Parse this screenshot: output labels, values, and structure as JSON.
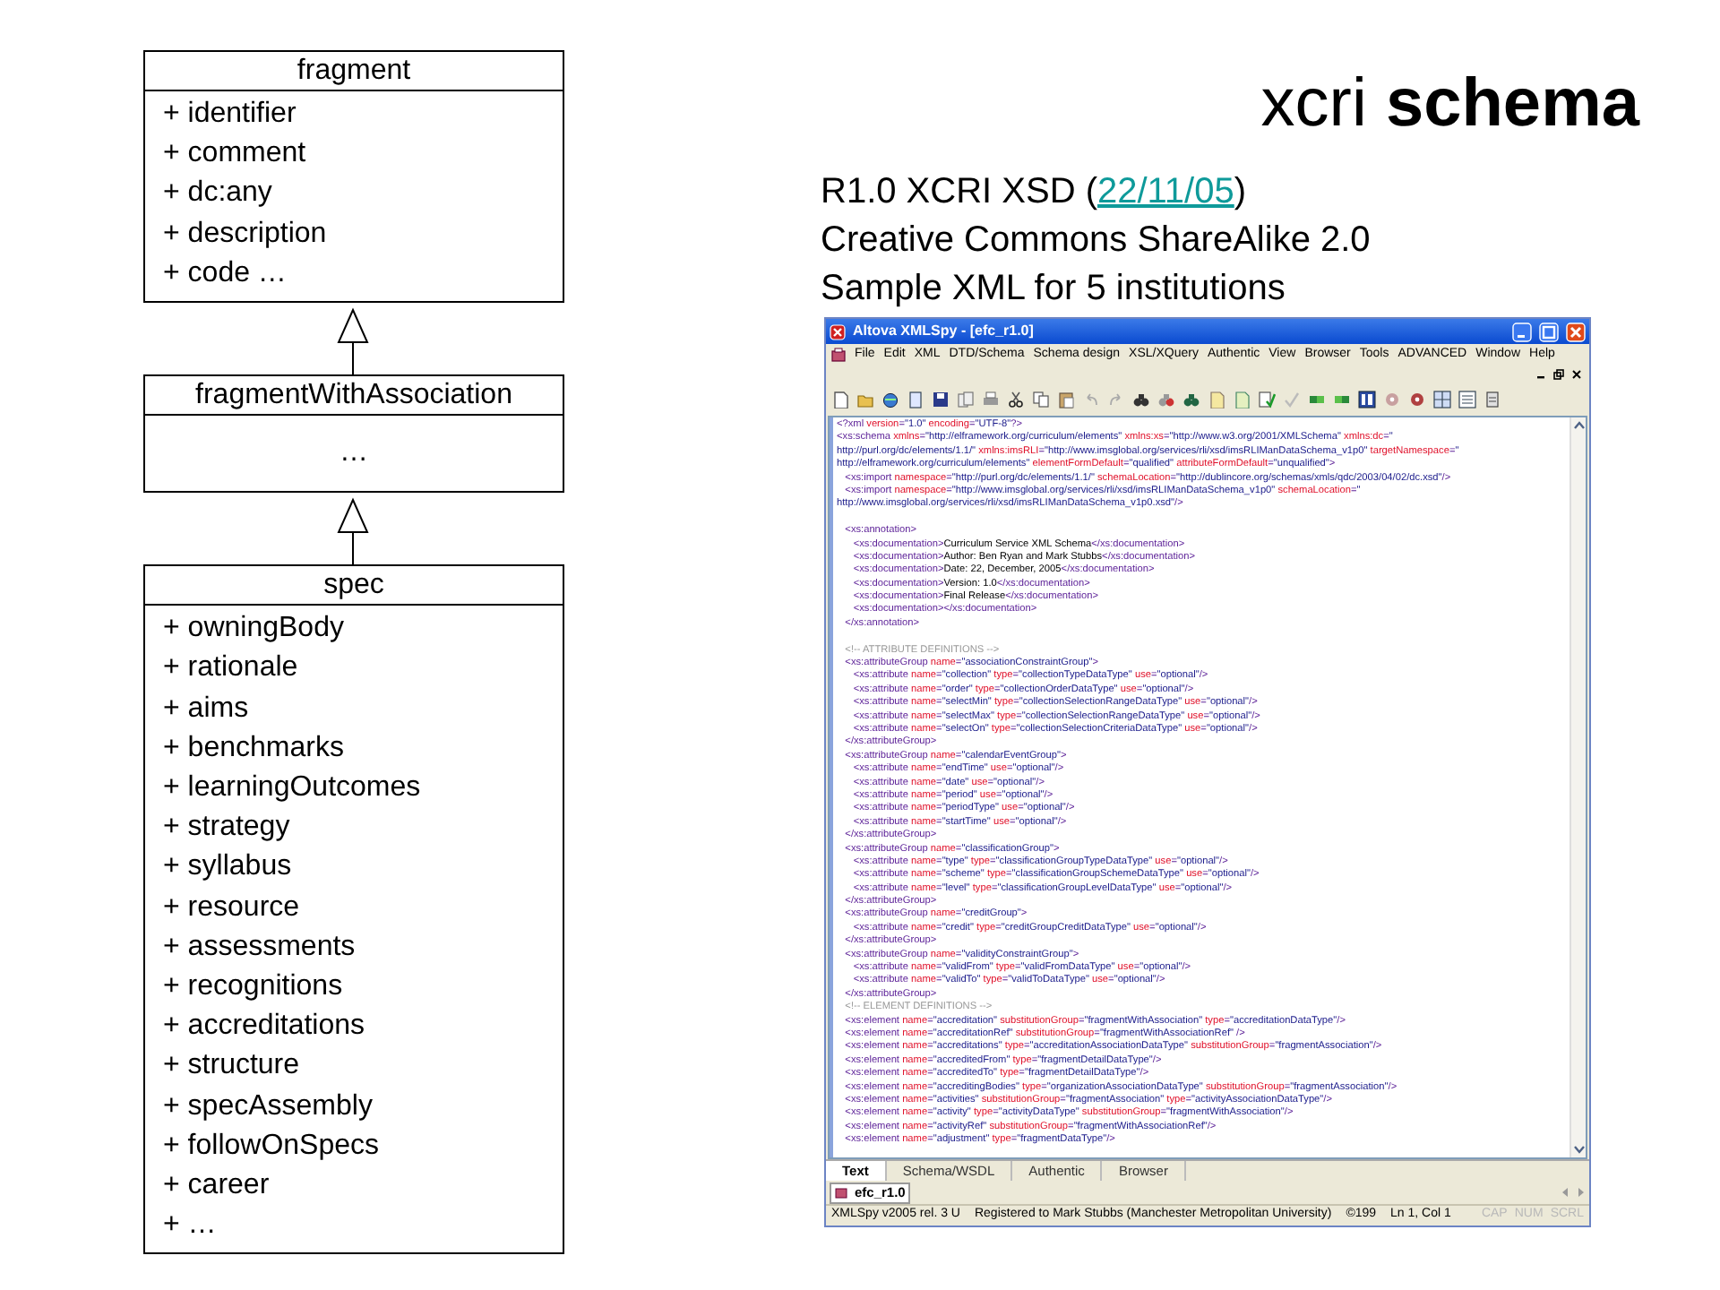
{
  "slide": {
    "title": "xcri **schema**",
    "info_lines": [
      {
        "prefix": "R1.0 XCRI XSD (",
        "link": "22/11/05",
        "suffix": ")"
      },
      {
        "prefix": "Creative Commons ShareAlike 2.0"
      },
      {
        "prefix": "Sample XML for 5 institutions"
      }
    ]
  },
  "diagram": {
    "classes": [
      {
        "name": "fragment",
        "members": [
          "+ identifier",
          "+ comment",
          "+ dc:any",
          "+ description",
          "+ code …"
        ]
      },
      {
        "name": "fragmentWithAssociation",
        "members": [
          "…"
        ]
      },
      {
        "name": "spec",
        "members": [
          "+ owningBody",
          "+ rationale",
          "+ aims",
          "+ benchmarks",
          "+ learningOutcomes",
          "+ strategy",
          "+ syllabus",
          "+ resource",
          "+ assessments",
          "+ recognitions",
          "+ accreditations",
          "+ structure",
          "+ specAssembly",
          "+ followOnSpecs",
          "+ career",
          "+ …"
        ]
      }
    ]
  },
  "app_window": {
    "title": "Altova XMLSpy - [efc_r1.0]",
    "menu": [
      "File",
      "Edit",
      "XML",
      "DTD/Schema",
      "Schema design",
      "XSL/XQuery",
      "Authentic",
      "View",
      "Browser",
      "Tools",
      "ADVANCED",
      "Window",
      "Help"
    ],
    "code_lines": [
      {
        "text": "<?xml version=\"1.0\" encoding=\"UTF-8\"?>",
        "gap_before": false
      },
      {
        "text": "<xs:schema xmlns=\"http://elframework.org/curriculum/elements\" xmlns:xs=\"http://www.w3.org/2001/XMLSchema\" xmlns:dc=\"",
        "gap_before": false
      },
      {
        "text": "http://purl.org/dc/elements/1.1/\" xmlns:imsRLI=\"http://www.imsglobal.org/services/rli/xsd/imsRLIManDataSchema_v1p0\" targetNamespace=\"",
        "gap_before": false
      },
      {
        "text": "http://elframework.org/curriculum/elements\" elementFormDefault=\"qualified\" attributeFormDefault=\"unqualified\">",
        "gap_before": false
      },
      {
        "text": "   <xs:import namespace=\"http://purl.org/dc/elements/1.1/\" schemaLocation=\"http://dublincore.org/schemas/xmls/qdc/2003/04/02/dc.xsd\"/>",
        "gap_before": false
      },
      {
        "text": "   <xs:import namespace=\"http://www.imsglobal.org/services/rli/xsd/imsRLIManDataSchema_v1p0\" schemaLocation=\"",
        "gap_before": false
      },
      {
        "text": "http://www.imsglobal.org/services/rli/xsd/imsRLIManDataSchema_v1p0.xsd\"/>",
        "gap_before": false
      },
      {
        "text": "   <xs:annotation>",
        "gap_before": true
      },
      {
        "text": "      <xs:documentation>Curriculum Service XML Schema</xs:documentation>",
        "gap_before": false
      },
      {
        "text": "      <xs:documentation>Author: Ben Ryan and Mark Stubbs</xs:documentation>",
        "gap_before": false
      },
      {
        "text": "      <xs:documentation>Date: 22, December, 2005</xs:documentation>",
        "gap_before": false
      },
      {
        "text": "      <xs:documentation>Version: 1.0</xs:documentation>",
        "gap_before": false
      },
      {
        "text": "      <xs:documentation>Final Release</xs:documentation>",
        "gap_before": false
      },
      {
        "text": "      <xs:documentation></xs:documentation>",
        "gap_before": false
      },
      {
        "text": "   </xs:annotation>",
        "gap_before": false
      },
      {
        "text": "   <!-- ATTRIBUTE DEFINITIONS -->",
        "gap_before": true
      },
      {
        "text": "   <xs:attributeGroup name=\"associationConstraintGroup\">",
        "gap_before": false
      },
      {
        "text": "      <xs:attribute name=\"collection\" type=\"collectionTypeDataType\" use=\"optional\"/>",
        "gap_before": false
      },
      {
        "text": "      <xs:attribute name=\"order\" type=\"collectionOrderDataType\" use=\"optional\"/>",
        "gap_before": false
      },
      {
        "text": "      <xs:attribute name=\"selectMin\" type=\"collectionSelectionRangeDataType\" use=\"optional\"/>",
        "gap_before": false
      },
      {
        "text": "      <xs:attribute name=\"selectMax\" type=\"collectionSelectionRangeDataType\" use=\"optional\"/>",
        "gap_before": false
      },
      {
        "text": "      <xs:attribute name=\"selectOn\" type=\"collectionSelectionCriteriaDataType\" use=\"optional\"/>",
        "gap_before": false
      },
      {
        "text": "   </xs:attributeGroup>",
        "gap_before": false
      },
      {
        "text": "   <xs:attributeGroup name=\"calendarEventGroup\">",
        "gap_before": false
      },
      {
        "text": "      <xs:attribute name=\"endTime\" use=\"optional\"/>",
        "gap_before": false
      },
      {
        "text": "      <xs:attribute name=\"date\" use=\"optional\"/>",
        "gap_before": false
      },
      {
        "text": "      <xs:attribute name=\"period\" use=\"optional\"/>",
        "gap_before": false
      },
      {
        "text": "      <xs:attribute name=\"periodType\" use=\"optional\"/>",
        "gap_before": false
      },
      {
        "text": "      <xs:attribute name=\"startTime\" use=\"optional\"/>",
        "gap_before": false
      },
      {
        "text": "   </xs:attributeGroup>",
        "gap_before": false
      },
      {
        "text": "   <xs:attributeGroup name=\"classificationGroup\">",
        "gap_before": false
      },
      {
        "text": "      <xs:attribute name=\"type\" type=\"classificationGroupTypeDataType\" use=\"optional\"/>",
        "gap_before": false
      },
      {
        "text": "      <xs:attribute name=\"scheme\" type=\"classificationGroupSchemeDataType\" use=\"optional\"/>",
        "gap_before": false
      },
      {
        "text": "      <xs:attribute name=\"level\" type=\"classificationGroupLevelDataType\" use=\"optional\"/>",
        "gap_before": false
      },
      {
        "text": "   </xs:attributeGroup>",
        "gap_before": false
      },
      {
        "text": "   <xs:attributeGroup name=\"creditGroup\">",
        "gap_before": false
      },
      {
        "text": "      <xs:attribute name=\"credit\" type=\"creditGroupCreditDataType\" use=\"optional\"/>",
        "gap_before": false
      },
      {
        "text": "   </xs:attributeGroup>",
        "gap_before": false
      },
      {
        "text": "   <xs:attributeGroup name=\"validityConstraintGroup\">",
        "gap_before": false
      },
      {
        "text": "      <xs:attribute name=\"validFrom\" type=\"validFromDataType\" use=\"optional\"/>",
        "gap_before": false
      },
      {
        "text": "      <xs:attribute name=\"validTo\" type=\"validToDataType\" use=\"optional\"/>",
        "gap_before": false
      },
      {
        "text": "   </xs:attributeGroup>",
        "gap_before": false
      },
      {
        "text": "   <!-- ELEMENT DEFINITIONS -->",
        "gap_before": false
      },
      {
        "text": "   <xs:element name=\"accreditation\" substitutionGroup=\"fragmentWithAssociation\" type=\"accreditationDataType\"/>",
        "gap_before": false
      },
      {
        "text": "   <xs:element name=\"accreditationRef\" substitutionGroup=\"fragmentWithAssociationRef\" />",
        "gap_before": false
      },
      {
        "text": "   <xs:element name=\"accreditations\" type=\"accreditationAssociationDataType\" substitutionGroup=\"fragmentAssociation\"/>",
        "gap_before": false
      },
      {
        "text": "   <xs:element name=\"accreditedFrom\" type=\"fragmentDetailDataType\"/>",
        "gap_before": false
      },
      {
        "text": "   <xs:element name=\"accreditedTo\" type=\"fragmentDetailDataType\"/>",
        "gap_before": false
      },
      {
        "text": "   <xs:element name=\"accreditingBodies\" type=\"organizationAssociationDataType\" substitutionGroup=\"fragmentAssociation\"/>",
        "gap_before": false
      },
      {
        "text": "   <xs:element name=\"activities\" substitutionGroup=\"fragmentAssociation\" type=\"activityAssociationDataType\"/>",
        "gap_before": false
      },
      {
        "text": "   <xs:element name=\"activity\" type=\"activityDataType\" substitutionGroup=\"fragmentWithAssociation\"/>",
        "gap_before": false
      },
      {
        "text": "   <xs:element name=\"activityRef\" substitutionGroup=\"fragmentWithAssociationRef\"/>",
        "gap_before": false
      },
      {
        "text": "   <xs:element name=\"adjustment\" type=\"fragmentDataType\"/>",
        "gap_before": false
      }
    ],
    "view_tabs": [
      {
        "label": "Text",
        "selected": true
      },
      {
        "label": "Schema/WSDL",
        "selected": false
      },
      {
        "label": "Authentic",
        "selected": false
      },
      {
        "label": "Browser",
        "selected": false
      }
    ],
    "document_tab": "efc_r1.0",
    "status_bar": {
      "version": "XMLSpy v2005 rel. 3 U",
      "registration": "Registered to Mark Stubbs (Manchester Metropolitan University)",
      "copyright": "©199",
      "position": "Ln 1, Col 1",
      "indicators": [
        {
          "label": "CAP",
          "on": false
        },
        {
          "label": "NUM",
          "on": false
        },
        {
          "label": "SCRL",
          "on": false
        }
      ]
    }
  }
}
